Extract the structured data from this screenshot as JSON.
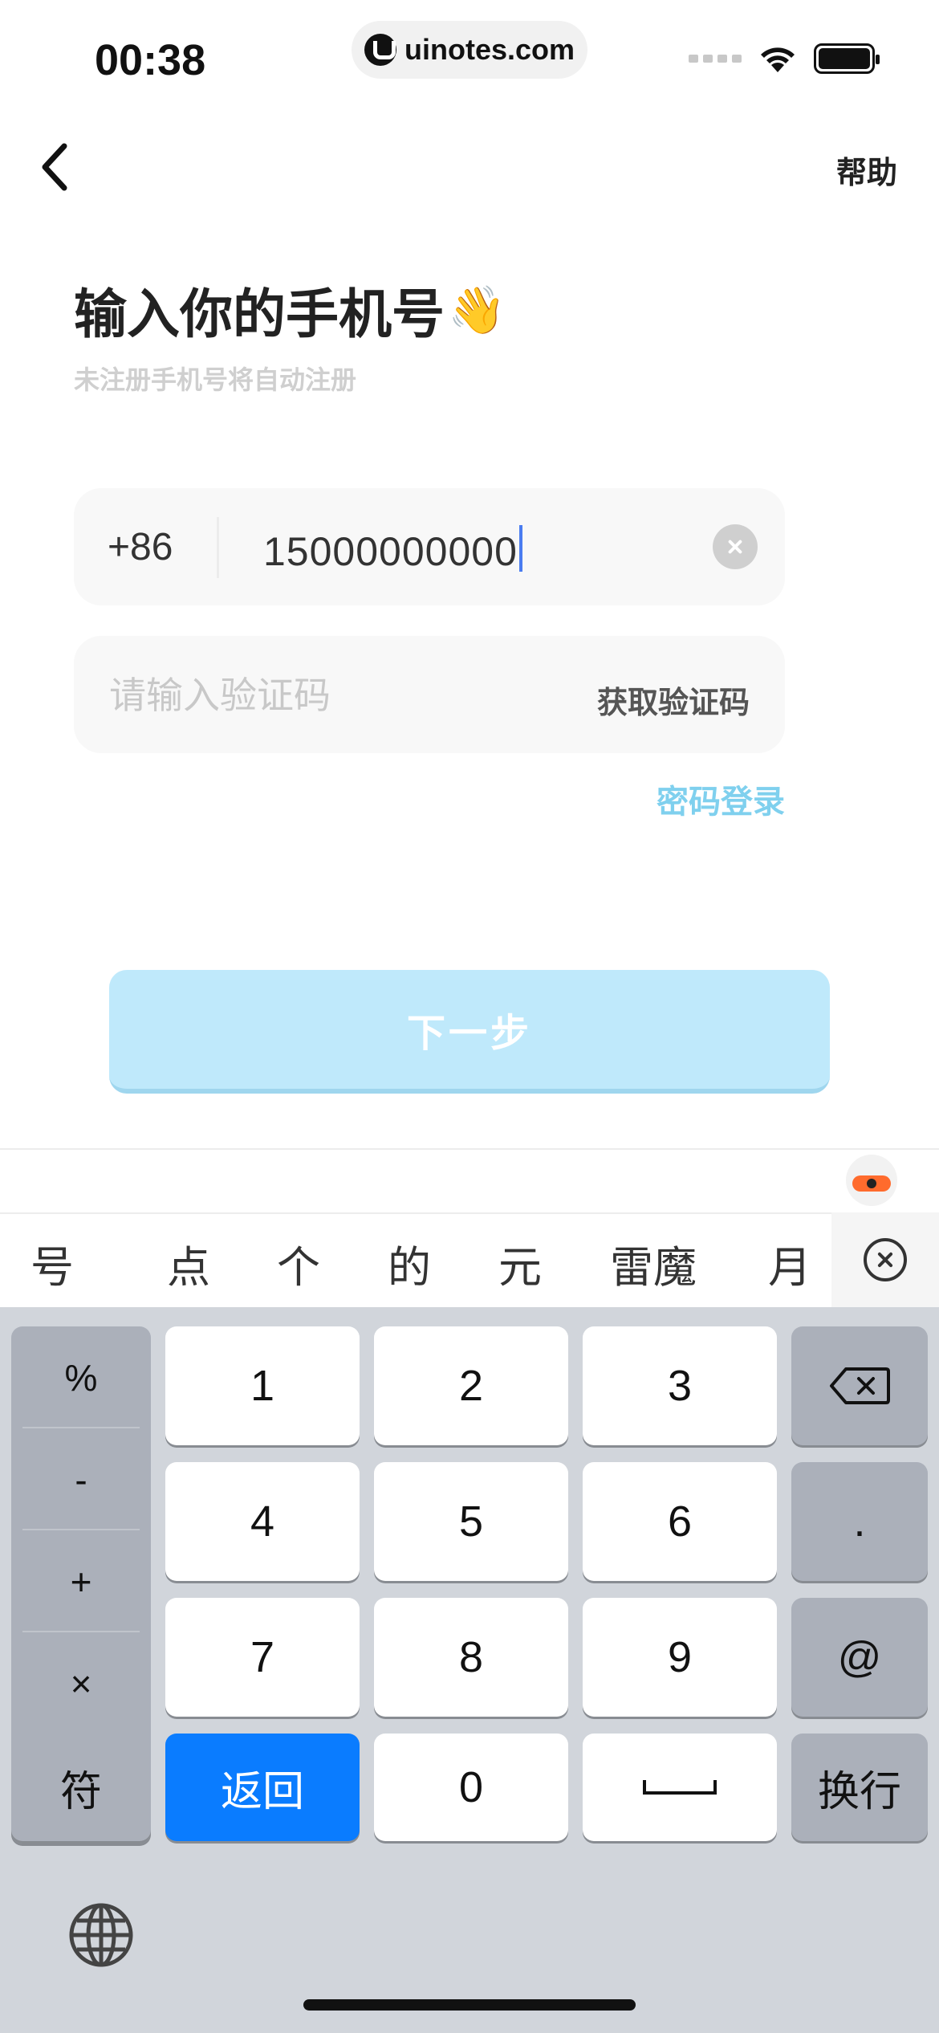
{
  "status_bar": {
    "time": "00:38",
    "url": "uinotes.com"
  },
  "nav": {
    "help_label": "帮助"
  },
  "header": {
    "title": "输入你的手机号",
    "title_emoji": "👋",
    "subtitle": "未注册手机号将自动注册"
  },
  "phone_field": {
    "country_code": "+86",
    "value": "15000000000"
  },
  "code_field": {
    "placeholder": "请输入验证码",
    "get_code_label": "获取验证码"
  },
  "password_login_label": "密码登录",
  "next_button_label": "下一步",
  "keyboard": {
    "candidates": [
      "号",
      "点",
      "个",
      "的",
      "元",
      "雷魔",
      "月"
    ],
    "symbols": [
      "%",
      "-",
      "+",
      "×"
    ],
    "digits": [
      "1",
      "2",
      "3",
      "4",
      "5",
      "6",
      "7",
      "8",
      "9",
      "0"
    ],
    "dot_label": ".",
    "at_label": "@",
    "symbol_switch_label": "符",
    "return_label": "返回",
    "newline_label": "换行"
  },
  "colors": {
    "accent": "#7fd0ee",
    "next_button_bg": "#bfe9fb",
    "keyboard_blue": "#0a7cff"
  }
}
